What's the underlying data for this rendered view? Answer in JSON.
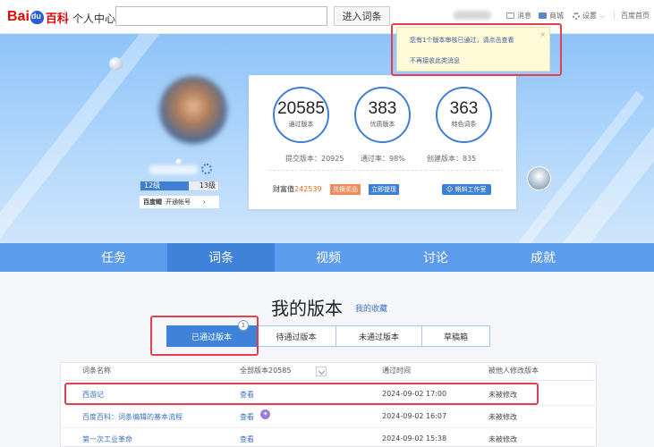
{
  "topbar": {
    "logo_bai": "Bai",
    "logo_bk": "百科",
    "title": "个人中心",
    "search_placeholder": "",
    "search_button": "进入词条",
    "links": [
      "消息",
      "商城",
      "设置",
      "百度首页"
    ]
  },
  "notice": {
    "line1": "您有1个版本审核已通过，请点击查看",
    "line2": "不再接收此类消息",
    "close": "×"
  },
  "profile": {
    "level_left": "12级",
    "level_right": "13级",
    "level_progress": 0.62,
    "account_brand": "百度帽",
    "account_action": "开通帐号",
    "account_arrow": "›"
  },
  "stats": {
    "items": [
      {
        "value": "20585",
        "label": "通过版本"
      },
      {
        "value": "383",
        "label": "优质版本"
      },
      {
        "value": "363",
        "label": "特色词条"
      }
    ],
    "submitted": "提交版本：20925",
    "pass_rate": "通过率：98%",
    "created": "创建版本：835",
    "wealth_label": "财富值",
    "wealth_value": "242539",
    "exchange": "兑换奖品",
    "withdraw": "立即提现",
    "studio": "蝌蚪工作室"
  },
  "nav": {
    "tabs": [
      "任务",
      "词条",
      "视频",
      "讨论",
      "成就"
    ],
    "active_index": 1
  },
  "content": {
    "heading": "我的版本",
    "favorites": "我的收藏",
    "subtabs": [
      "已通过版本",
      "待通过版本",
      "未通过版本",
      "草稿箱"
    ],
    "badge": "1",
    "columns": [
      "词条名称",
      "全部版本20585",
      "通过时间",
      "被他人修改版本"
    ],
    "rows": [
      {
        "name": "西游记",
        "action": "查看",
        "time": "2024-09-02 17:00",
        "status": "未被修改"
      },
      {
        "name": "百度百科：词条编辑的基本流程",
        "action": "查看",
        "time": "2024-09-02 16:07",
        "status": "未被修改"
      },
      {
        "name": "第一次工业革命",
        "action": "查看",
        "time": "2024-09-02 15:38",
        "status": "未被修改"
      }
    ]
  },
  "colors": {
    "accent": "#3f82d9",
    "nav_bg": "#5b9cec",
    "highlight": "#e33f4f"
  }
}
